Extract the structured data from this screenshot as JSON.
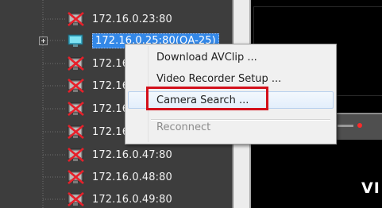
{
  "device_tree": {
    "items": [
      {
        "label": "172.16.0.23:80",
        "icon": "camera-offline-icon",
        "selected": false
      },
      {
        "label": "172.16.0.25:80(QA-25)",
        "icon": "camera-online-icon",
        "selected": true
      },
      {
        "label": "172.16.",
        "icon": "camera-offline-icon",
        "selected": false
      },
      {
        "label": "172.16.",
        "icon": "camera-offline-icon",
        "selected": false
      },
      {
        "label": "172.16.",
        "icon": "camera-offline-icon",
        "selected": false
      },
      {
        "label": "172.16.",
        "icon": "camera-offline-icon",
        "selected": false
      },
      {
        "label": "172.16.0.47:80",
        "icon": "camera-offline-icon",
        "selected": false
      },
      {
        "label": "172.16.0.48:80",
        "icon": "camera-offline-icon",
        "selected": false
      },
      {
        "label": "172.16.0.49:80",
        "icon": "camera-offline-icon",
        "selected": false
      }
    ]
  },
  "context_menu": {
    "items": [
      {
        "label": "Download AVClip ...",
        "enabled": true,
        "hovered": false
      },
      {
        "label": "Video Recorder Setup ...",
        "enabled": true,
        "hovered": false
      },
      {
        "label": "Camera Search ...",
        "enabled": true,
        "hovered": true
      },
      {
        "label": "Reconnect",
        "enabled": false,
        "hovered": false
      }
    ]
  },
  "video_panel": {
    "overlay_text": "VI"
  },
  "colors": {
    "selection": "#3388e8",
    "highlight_box": "#d3101b",
    "offline_x": "#e8202a",
    "online_monitor": "#4fc7e0",
    "tree_background": "#3d3d3d"
  }
}
